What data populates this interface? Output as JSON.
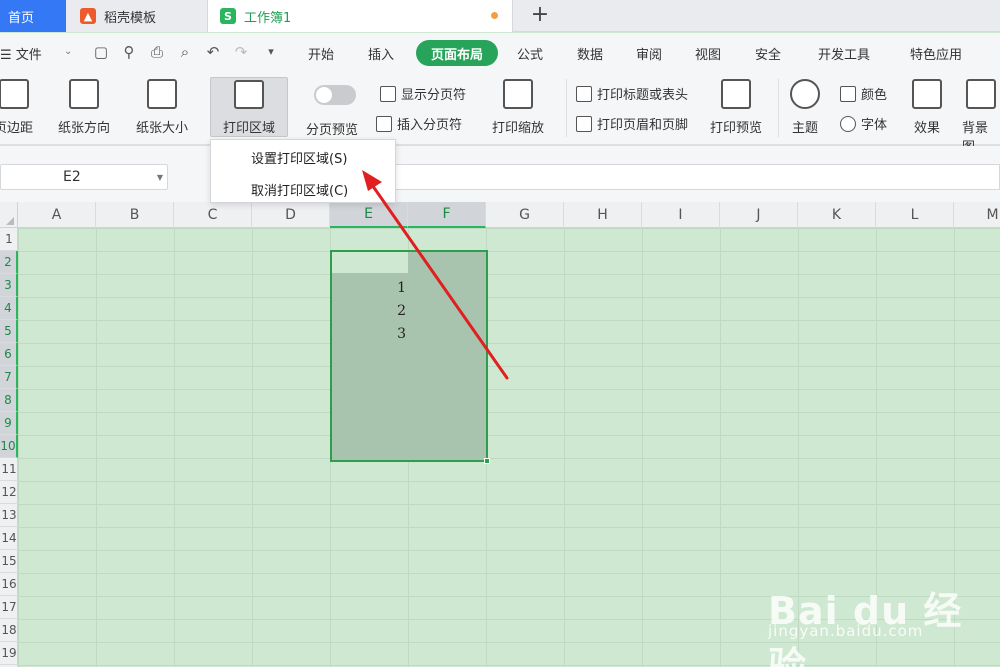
{
  "tabs": {
    "home": "首页",
    "templates": "稻壳模板",
    "workbook": "工作簿1",
    "workbook_logo": "S",
    "new_tab": "+"
  },
  "menu": {
    "file": "☰ 文件",
    "items": [
      "开始",
      "插入",
      "公式",
      "数据",
      "审阅",
      "视图",
      "安全",
      "开发工具",
      "特色应用"
    ],
    "active": "页面布局"
  },
  "ribbon": {
    "margins": "页边距",
    "orientation": "纸张方向",
    "size": "纸张大小",
    "print_area": "打印区域",
    "page_break_preview": "分页预览",
    "show_page_breaks": "显示分页符",
    "insert_page_break": "插入分页符",
    "print_scaling": "打印缩放",
    "print_titles": "打印标题或表头",
    "print_header_footer": "打印页眉和页脚",
    "print_preview": "打印预览",
    "theme": "主题",
    "colors": "颜色",
    "fonts": "字体",
    "effects": "效果",
    "background": "背景图"
  },
  "dropdown": {
    "set_print_area": "设置打印区域(S)",
    "clear_print_area": "取消打印区域(C)"
  },
  "name_box": "E2",
  "columns": [
    "A",
    "B",
    "C",
    "D",
    "E",
    "F",
    "G",
    "H",
    "I",
    "J",
    "K",
    "L",
    "M"
  ],
  "rows": [
    "1",
    "2",
    "3",
    "4",
    "5",
    "6",
    "7",
    "8",
    "9",
    "10",
    "11",
    "12",
    "13",
    "14",
    "15",
    "16",
    "17",
    "18",
    "19"
  ],
  "cells": {
    "e3": "1",
    "e4": "2",
    "e5": "3"
  },
  "watermark": {
    "brand": "Bai du 经验",
    "url": "jingyan.baidu.com"
  },
  "colors": {
    "accent_green": "#27a35a",
    "selection_border": "#2e9e4e",
    "arrow_red": "#e02020"
  }
}
